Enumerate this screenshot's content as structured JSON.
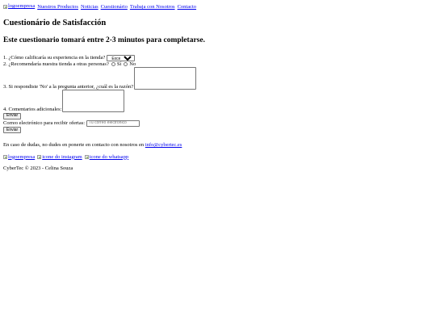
{
  "nav": {
    "logo_alt": "logoempresa",
    "links": [
      "Nuestros Productos",
      "Noticias",
      "Cuestionário",
      "Trabaja con Nosotros",
      "Contacto"
    ]
  },
  "page": {
    "title": "Cuestionário de Satisfacción",
    "subtitle": "Este cuestionario tomará entre 2-3 minutos para completarse."
  },
  "form": {
    "q1_label": "1. ¿Cómo calificaría su experiencia en la tienda?",
    "q1_selected": "Excelente",
    "q2_label": "2. ¿Recomendaría nuestra tienda a otras personas?",
    "q2_yes": "Sí",
    "q2_no": "No",
    "q3_label": "3. Si respondiste 'No' a la pregunta anterior, ¿cuál es la razón?",
    "q4_label": "4. Comentarios adicionales:",
    "submit_label": "Enviar",
    "email_label": "Correo electrónico para recibir ofertas:",
    "email_placeholder": "Tu correo electrónico",
    "email_submit_label": "Enviar"
  },
  "contact": {
    "text": "En caso de dudas, no dudes en ponerte en contacto con nosotros en",
    "email": "info@cybertec.es"
  },
  "footer_icons": {
    "logo_alt": "logoempresa",
    "instagram_alt": "icone do instagram",
    "whatsapp_alt": "icone do whatsapp"
  },
  "footer": {
    "copyright": "CyberTec © 2023 - Celina Souza"
  }
}
